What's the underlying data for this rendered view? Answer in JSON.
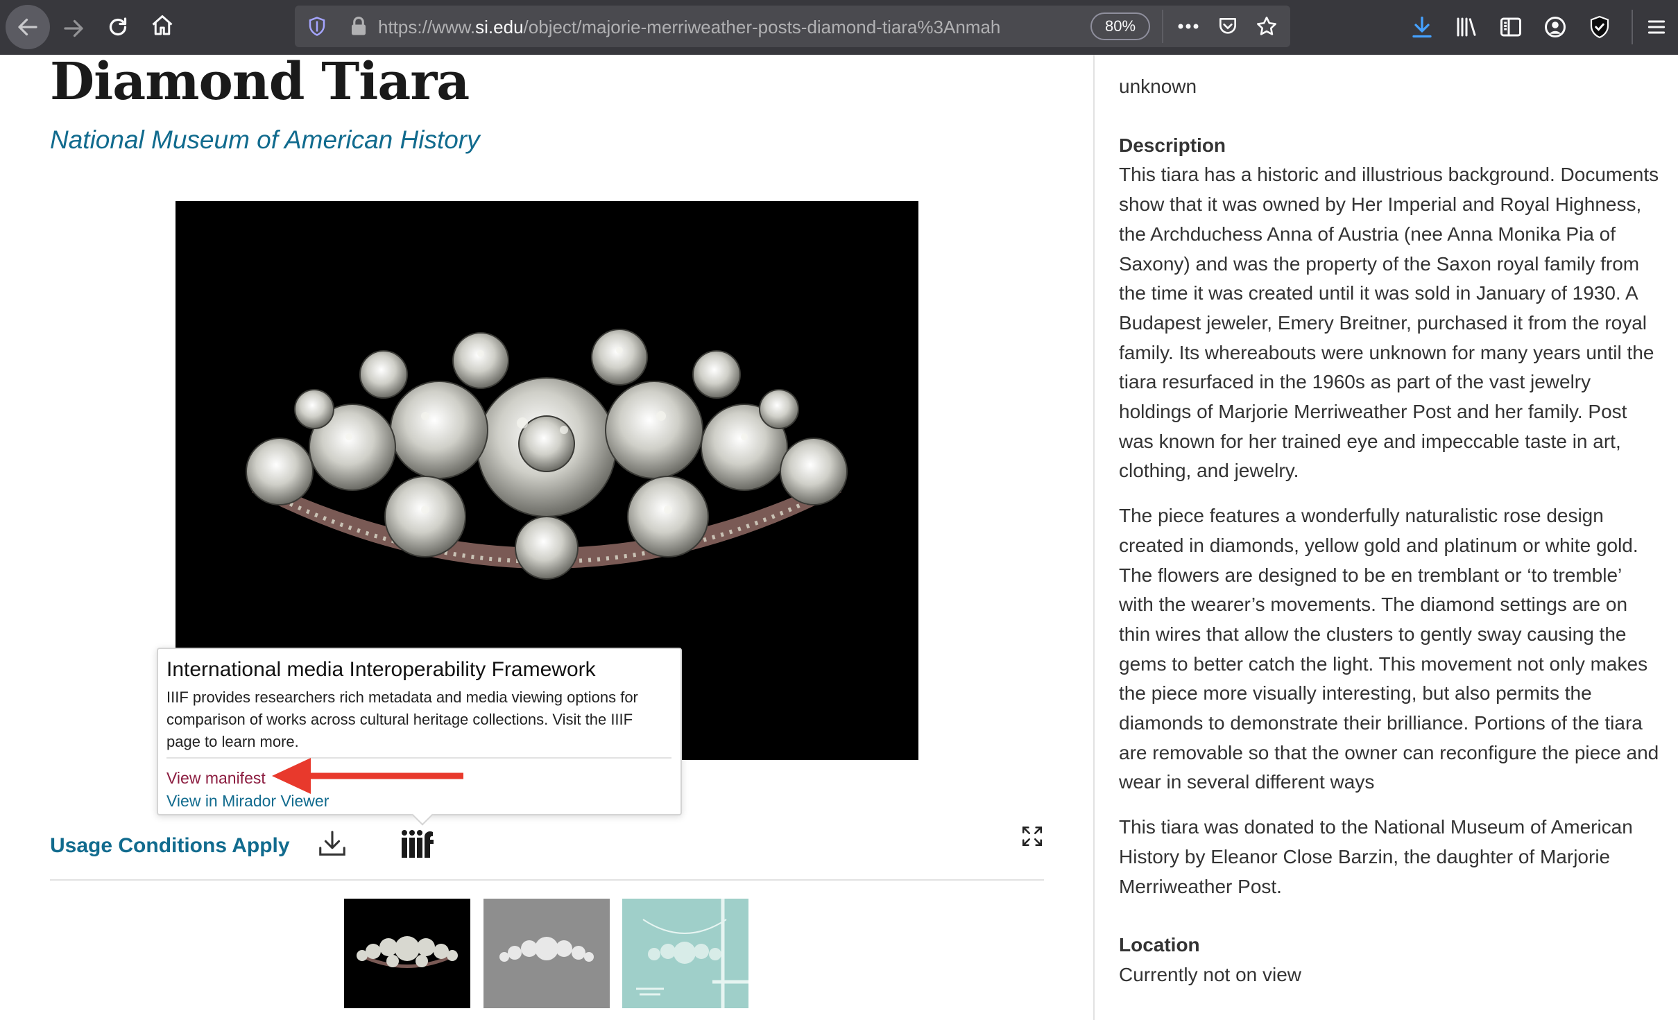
{
  "browser": {
    "url_prefix": "https://www.",
    "url_domain": "si.edu",
    "url_path": "/object/majorie-merriweather-posts-diamond-tiara%3Anmah",
    "zoom": "80%"
  },
  "page": {
    "title": "Diamond Tiara",
    "museum": "National Museum of American History"
  },
  "iiif_popover": {
    "title": "International media Interoperability Framework",
    "body": "IIIF provides researchers rich metadata and media viewing options for comparison of works across cultural heritage collections. Visit the IIIF page to learn more.",
    "view_manifest": "View manifest",
    "view_mirador": "View in Mirador Viewer"
  },
  "media_bar": {
    "usage_conditions": "Usage Conditions Apply"
  },
  "details": {
    "maker_value": "unknown",
    "description_label": "Description",
    "description_paragraphs": [
      "This tiara has a historic and illustrious background. Documents show that it was owned by Her Imperial and Royal Highness, the Archduchess Anna of Austria (nee Anna Monika Pia of Saxony) and was the property of the Saxon royal family from the time it was created until it was sold in January of 1930. A Budapest jeweler, Emery Breitner, purchased it from the royal family. Its whereabouts were unknown for many years until the tiara resurfaced in the 1960s as part of the vast jewelry holdings of Marjorie Merriweather Post and her family. Post was known for her trained eye and impeccable taste in art, clothing, and jewelry.",
      "The piece features a wonderfully naturalistic rose design created in diamonds, yellow gold and platinum or white gold. The flowers are designed to be en tremblant or ‘to tremble’ with the wearer’s movements. The diamond settings are on thin wires that allow the clusters to gently sway causing the gems to better catch the light. This movement not only makes the piece more visually interesting, but also permits the diamonds to demonstrate their brilliance. Portions of the tiara are removable so that the owner can reconfigure the piece and wear in several different ways",
      "This tiara was donated to the National Museum of American History by Eleanor Close Barzin, the daughter of Marjorie Merriweather Post."
    ],
    "location_label": "Location",
    "location_value": "Currently not on view"
  },
  "icons": {
    "back": "back-arrow-icon",
    "forward": "forward-arrow-icon",
    "reload": "reload-icon",
    "home": "home-icon",
    "tracking": "tracking-shield-icon",
    "lock": "lock-icon",
    "more": "more-icon",
    "pocket": "pocket-icon",
    "bookmark": "star-icon",
    "downloads": "download-arrow-icon",
    "library": "library-icon",
    "sidebar": "sidebar-icon",
    "account": "account-icon",
    "shield": "privacy-shield-icon",
    "menu": "hamburger-menu-icon",
    "media_download": "download-icon",
    "iiif": "iiif-logo-icon",
    "fullscreen": "expand-icon"
  },
  "colors": {
    "link": "#116b8e",
    "manifest_link": "#8c1d40",
    "callout_arrow": "#e8392c",
    "toolbar": "#38383d"
  }
}
